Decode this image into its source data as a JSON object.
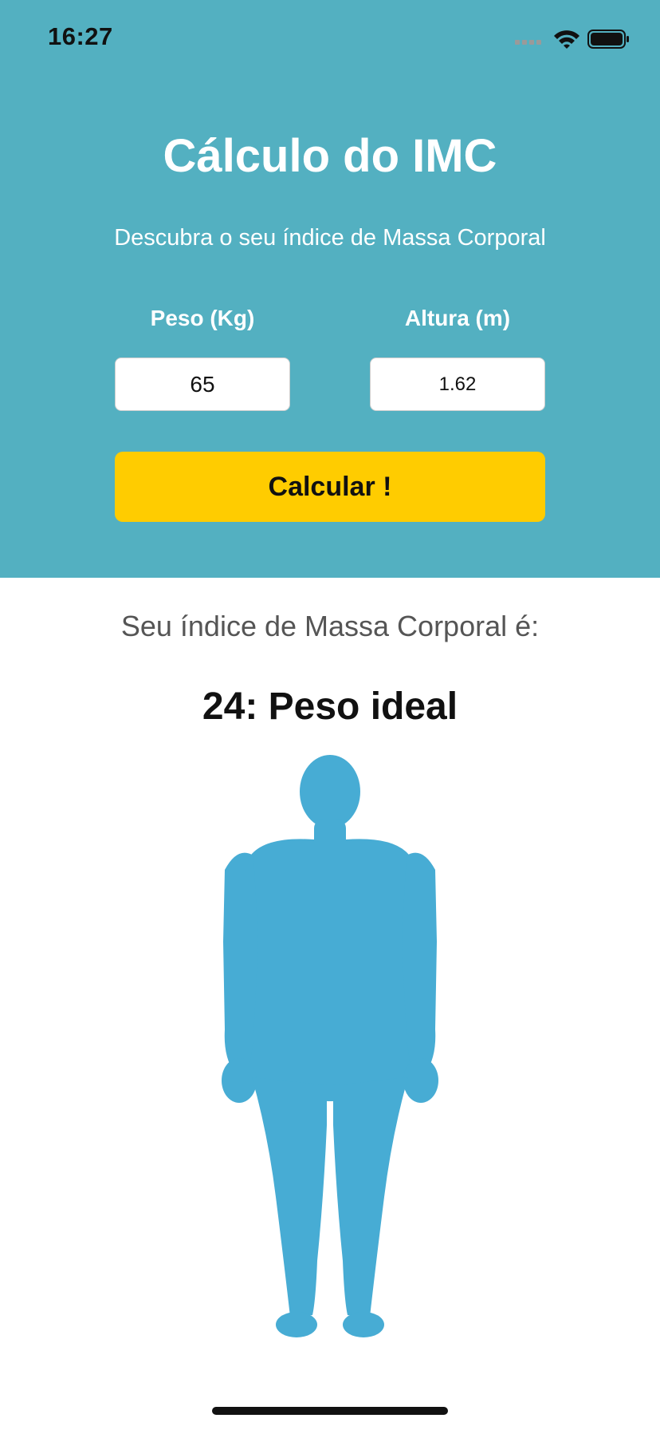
{
  "status_bar": {
    "time": "16:27",
    "icons": [
      "cellular-signal-icon",
      "wifi-icon",
      "battery-icon"
    ]
  },
  "header": {
    "background_color": "#53b0c1",
    "title": "Cálculo do IMC",
    "subtitle": "Descubra o seu índice de Massa Corporal"
  },
  "form": {
    "weight": {
      "label": "Peso (Kg)",
      "value": "65"
    },
    "height": {
      "label": "Altura (m)",
      "value": "1.62"
    },
    "calculate_button": {
      "label": "Calcular !",
      "color": "#ffcc00"
    }
  },
  "result": {
    "label": "Seu índice de Massa Corporal é:",
    "value": "24: Peso ideal",
    "image": "body-silhouette-icon",
    "image_color": "#47acd4"
  }
}
